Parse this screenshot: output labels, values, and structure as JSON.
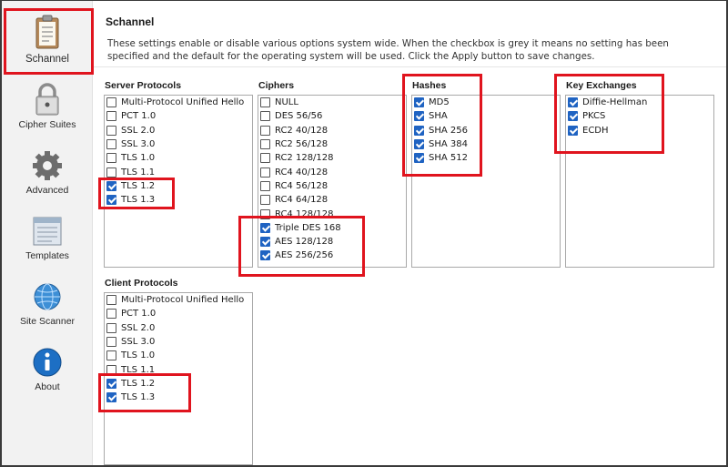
{
  "sidebar": {
    "items": [
      {
        "label": "Schannel",
        "icon": "clipboard-icon",
        "active": true
      },
      {
        "label": "Cipher Suites",
        "icon": "padlock-icon"
      },
      {
        "label": "Advanced",
        "icon": "gear-icon"
      },
      {
        "label": "Templates",
        "icon": "template-icon"
      },
      {
        "label": "Site Scanner",
        "icon": "globe-icon"
      },
      {
        "label": "About",
        "icon": "info-icon"
      }
    ]
  },
  "header": {
    "title": "Schannel",
    "description": "These settings enable or disable various options system wide. When the checkbox is grey it means no setting has been specified and the default for the operating system will be used. Click the Apply button to save changes."
  },
  "groups": {
    "server_protocols": {
      "title": "Server Protocols",
      "items": [
        {
          "label": "Multi-Protocol Unified Hello",
          "checked": false
        },
        {
          "label": "PCT 1.0",
          "checked": false
        },
        {
          "label": "SSL 2.0",
          "checked": false
        },
        {
          "label": "SSL 3.0",
          "checked": false
        },
        {
          "label": "TLS 1.0",
          "checked": false
        },
        {
          "label": "TLS 1.1",
          "checked": false
        },
        {
          "label": "TLS 1.2",
          "checked": true
        },
        {
          "label": "TLS 1.3",
          "checked": true
        }
      ]
    },
    "ciphers": {
      "title": "Ciphers",
      "items": [
        {
          "label": "NULL",
          "checked": false
        },
        {
          "label": "DES 56/56",
          "checked": false
        },
        {
          "label": "RC2 40/128",
          "checked": false
        },
        {
          "label": "RC2 56/128",
          "checked": false
        },
        {
          "label": "RC2 128/128",
          "checked": false
        },
        {
          "label": "RC4 40/128",
          "checked": false
        },
        {
          "label": "RC4 56/128",
          "checked": false
        },
        {
          "label": "RC4 64/128",
          "checked": false
        },
        {
          "label": "RC4 128/128",
          "checked": false
        },
        {
          "label": "Triple DES 168",
          "checked": true
        },
        {
          "label": "AES 128/128",
          "checked": true
        },
        {
          "label": "AES 256/256",
          "checked": true
        }
      ]
    },
    "hashes": {
      "title": "Hashes",
      "items": [
        {
          "label": "MD5",
          "checked": true
        },
        {
          "label": "SHA",
          "checked": true
        },
        {
          "label": "SHA 256",
          "checked": true
        },
        {
          "label": "SHA 384",
          "checked": true
        },
        {
          "label": "SHA 512",
          "checked": true
        }
      ]
    },
    "key_exchanges": {
      "title": "Key Exchanges",
      "items": [
        {
          "label": "Diffie-Hellman",
          "checked": true
        },
        {
          "label": "PKCS",
          "checked": true
        },
        {
          "label": "ECDH",
          "checked": true
        }
      ]
    },
    "client_protocols": {
      "title": "Client Protocols",
      "items": [
        {
          "label": "Multi-Protocol Unified Hello",
          "checked": false
        },
        {
          "label": "PCT 1.0",
          "checked": false
        },
        {
          "label": "SSL 2.0",
          "checked": false
        },
        {
          "label": "SSL 3.0",
          "checked": false
        },
        {
          "label": "TLS 1.0",
          "checked": false
        },
        {
          "label": "TLS 1.1",
          "checked": false
        },
        {
          "label": "TLS 1.2",
          "checked": true
        },
        {
          "label": "TLS 1.3",
          "checked": true
        }
      ]
    }
  },
  "colors": {
    "accent": "#1f63c2",
    "highlight": "#e0141e"
  }
}
